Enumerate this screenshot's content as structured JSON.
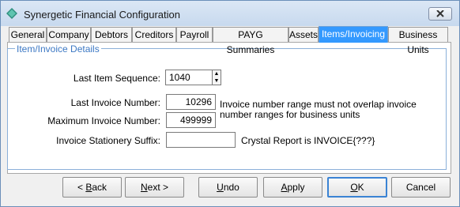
{
  "window": {
    "title": "Synergetic Financial Configuration"
  },
  "tabs": [
    {
      "label": "General"
    },
    {
      "label": "Company"
    },
    {
      "label": "Debtors"
    },
    {
      "label": "Creditors"
    },
    {
      "label": "Payroll"
    },
    {
      "label": "PAYG Summaries"
    },
    {
      "label": "Assets"
    },
    {
      "label": "Items/Invoicing",
      "active": true
    },
    {
      "label": "Business Units"
    }
  ],
  "group": {
    "title": "Item/Invoice Details"
  },
  "fields": {
    "last_item_sequence": {
      "label": "Last Item Sequence:",
      "value": "1040"
    },
    "last_invoice_number": {
      "label": "Last Invoice Number:",
      "value": "10296"
    },
    "maximum_invoice_number": {
      "label": "Maximum Invoice Number:",
      "value": "499999"
    },
    "stationery_suffix": {
      "label": "Invoice Stationery Suffix:",
      "value": ""
    }
  },
  "notes": {
    "range_line1": "Invoice number range must not overlap invoice",
    "range_line2": "number ranges for business units",
    "crystal": "Crystal Report is INVOICE{???}"
  },
  "buttons": {
    "back": {
      "pre": "< ",
      "u": "B",
      "post": "ack"
    },
    "next": {
      "pre": "",
      "u": "N",
      "post": "ext >"
    },
    "undo": {
      "pre": "",
      "u": "U",
      "post": "ndo"
    },
    "apply": {
      "pre": "",
      "u": "A",
      "post": "pply"
    },
    "ok": {
      "pre": "",
      "u": "O",
      "post": "K"
    },
    "cancel": {
      "pre": "",
      "u": "",
      "post": "Cancel"
    }
  },
  "colors": {
    "active_tab": "#3399ff",
    "group_title": "#3c78c4"
  },
  "icons": {
    "app": "diamond-app-icon",
    "close": "close-icon"
  }
}
